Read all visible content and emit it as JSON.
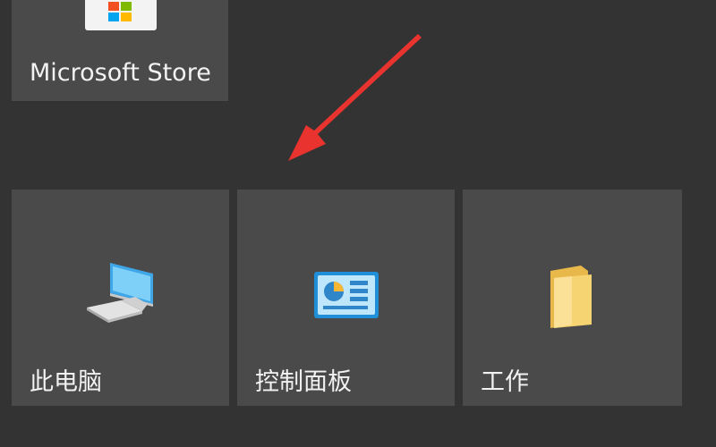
{
  "tiles": {
    "store": {
      "label": "Microsoft Store",
      "icon": "microsoft-store-icon"
    },
    "this_pc": {
      "label": "此电脑",
      "icon": "computer-icon"
    },
    "control_panel": {
      "label": "控制面板",
      "icon": "control-panel-icon"
    },
    "work": {
      "label": "工作",
      "icon": "folder-icon"
    }
  },
  "colors": {
    "background": "#333333",
    "tile": "#4a4a4a",
    "label": "#f2f2f2",
    "arrow": "#e8332e"
  }
}
